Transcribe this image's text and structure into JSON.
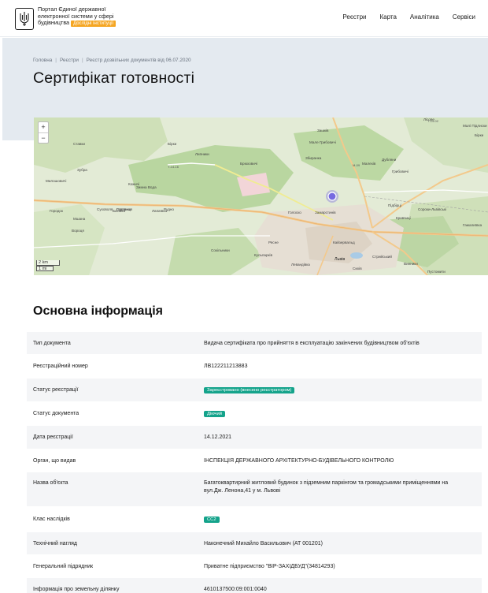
{
  "header": {
    "brand_line1": "Портал Єдиної державної",
    "brand_line2": "електронної системи у сфері",
    "brand_line3": "будівництва",
    "badge": "Дослідні інституції",
    "nav": [
      "Реєстри",
      "Карта",
      "Аналітика",
      "Сервіси"
    ]
  },
  "breadcrumb": [
    "Головна",
    "Реєстри",
    "Реєстр дозвільних документів від 06.07.2020"
  ],
  "page_title": "Сертифікат готовності",
  "map": {
    "zoom_in": "+",
    "zoom_out": "−",
    "scale_km": "2 km",
    "scale_mi": "1 mi",
    "labels": [
      {
        "text": "Лісове"
      },
      {
        "text": "Зашків"
      },
      {
        "text": "Малі Підлиски"
      },
      {
        "text": "Бірки"
      },
      {
        "text": "Мале Грибовичі"
      },
      {
        "text": "Дубляни"
      },
      {
        "text": "Брюховичі"
      },
      {
        "text": "Малехів"
      },
      {
        "text": "Зимна Вода"
      },
      {
        "text": "Рудно"
      },
      {
        "text": "Сокільники"
      },
      {
        "text": "Винники"
      },
      {
        "text": "Львів"
      },
      {
        "text": "Підбірці"
      },
      {
        "text": "Кривчиці"
      },
      {
        "text": "Сороки-Львівські"
      },
      {
        "text": "Городок"
      },
      {
        "text": "Мшана"
      },
      {
        "text": "Солонка"
      },
      {
        "text": "Пустомити"
      },
      {
        "text": "Лапаївка"
      },
      {
        "text": "Левандівка"
      },
      {
        "text": "Голоско"
      },
      {
        "text": "Замарстинів"
      },
      {
        "text": "Сихів"
      },
      {
        "text": "Кульпарків"
      },
      {
        "text": "Зубра"
      },
      {
        "text": "Ставки"
      },
      {
        "text": "Кожичі"
      },
      {
        "text": "Басівка"
      },
      {
        "text": "Милошовичі"
      }
    ]
  },
  "section_title": "Основна інформація",
  "rows": [
    {
      "key": "Тип документа",
      "value": "Видача сертифіката про прийняття в експлуатацію закінчених будівництвом об'єктів"
    },
    {
      "key": "Реєстраційний номер",
      "value": "ЛВ122211213883"
    },
    {
      "key": "Статус реєстрації",
      "value": "Зареєстровано (внесено реєстратором)"
    },
    {
      "key": "Статус документа",
      "value": "Діючий"
    },
    {
      "key": "Дата реєстрації",
      "value": "14.12.2021"
    },
    {
      "key": "Орган, що видав",
      "value": "ІНСПЕКЦІЯ ДЕРЖАВНОГО АРХІТЕКТУРНО-БУДІВЕЛЬНОГО КОНТРОЛЮ"
    },
    {
      "key": "Назва об'єкта",
      "value": "Багатоквартирний житловий будинок з підземним паркінгом та громадськими приміщеннями на вул.Дж. Ленона,41 у м. Львові"
    },
    {
      "key": "Клас наслідків",
      "value": "СС2"
    },
    {
      "key": "Технічний нагляд",
      "value": "Наконечний Михайло Васильович (АТ 001201)"
    },
    {
      "key": "Генеральний підрядник",
      "value": "Приватне підприємство \"ВІР-ЗАХІДБУД\"(34814293)"
    },
    {
      "key": "Інформація про земельну ділянку",
      "value": "4610137500:09:001:0040"
    }
  ],
  "colors": {
    "accent_badge": "#f5a623",
    "status_pill": "#14a38b",
    "hero_bg": "#e4eaf0",
    "marker": "#6a5be0"
  }
}
